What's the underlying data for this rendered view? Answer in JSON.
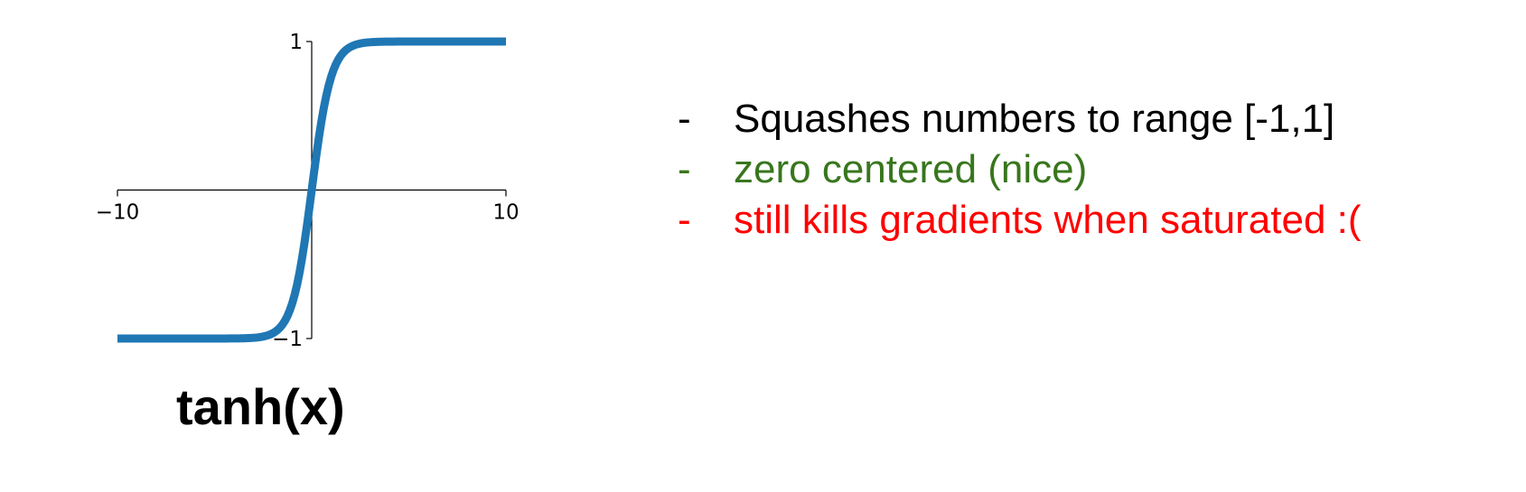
{
  "chart_data": {
    "type": "line",
    "function": "tanh",
    "xlim": [
      -10,
      10
    ],
    "ylim": [
      -1,
      1
    ],
    "x_ticks": [
      {
        "value": -10,
        "label": "−10"
      },
      {
        "value": 10,
        "label": "10"
      }
    ],
    "y_ticks": [
      {
        "value": 1,
        "label": "1"
      },
      {
        "value": -1,
        "label": "−1"
      }
    ],
    "series": [
      {
        "x_range": [
          -10,
          10
        ],
        "samples": 161,
        "color": "#1f77b4"
      }
    ],
    "grid": false
  },
  "caption": "tanh(x)",
  "bullets": [
    {
      "dash": "-",
      "text": "Squashes numbers to range [-1,1]",
      "color": "#000000"
    },
    {
      "dash": "-",
      "text": "zero centered (nice)",
      "color": "#38761d"
    },
    {
      "dash": "-",
      "text": "still kills gradients when saturated :(",
      "color": "#ff0000"
    }
  ]
}
